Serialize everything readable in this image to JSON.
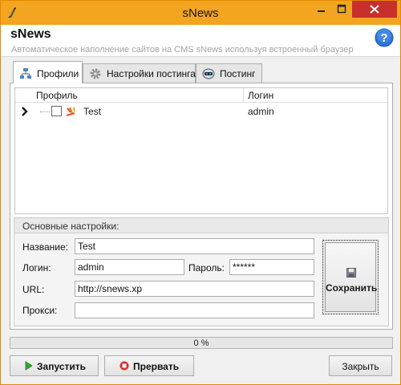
{
  "window": {
    "title": "sNews",
    "controls": {
      "minimize": "minimize-icon",
      "maximize": "maximize-icon",
      "close": "close-icon"
    }
  },
  "header": {
    "title": "sNews",
    "subtitle": "Автоматическое наполнение сайтов на CMS sNews используя встроенный браузер",
    "help_icon": "help-icon"
  },
  "tabs": [
    {
      "label": "Профили",
      "icon": "profiles-icon",
      "active": true
    },
    {
      "label": "Настройки постинга",
      "icon": "gear-icon",
      "active": false
    },
    {
      "label": "Постинг",
      "icon": "robot-icon",
      "active": false
    }
  ],
  "grid": {
    "columns": [
      "Профиль",
      "Логин"
    ],
    "rows": [
      {
        "name": "Test",
        "login": "admin",
        "checked": false
      }
    ]
  },
  "settings": {
    "title": "Основные настройки:",
    "name_label": "Название:",
    "name_value": "Test",
    "login_label": "Логин:",
    "login_value": "admin",
    "password_label": "Пароль:",
    "password_value": "******",
    "url_label": "URL:",
    "url_value": "http://snews.xp",
    "proxy_label": "Прокси:",
    "proxy_value": "",
    "save_label": "Сохранить"
  },
  "progress": {
    "value": 0,
    "text": "0 %"
  },
  "buttons": {
    "start": "Запустить",
    "stop": "Прервать",
    "close": "Закрыть"
  },
  "colors": {
    "titlebar": "#f3a51f",
    "close_button": "#c7302b",
    "start_icon": "#2cae2c",
    "stop_icon": "#d9332b"
  }
}
